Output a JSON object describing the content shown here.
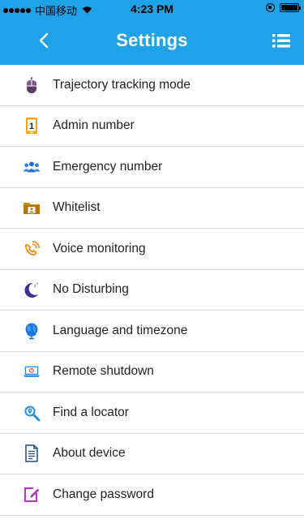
{
  "status_bar": {
    "carrier": "中国移动",
    "time": "4:23 PM"
  },
  "navbar": {
    "title": "Settings",
    "back_icon": "chevron-left-icon",
    "menu_icon": "list-menu-icon"
  },
  "colors": {
    "primary": "#1fa2e8",
    "divider": "#d9d9d9"
  },
  "settings": {
    "items": [
      {
        "label": "Trajectory tracking mode",
        "icon": "mouse-icon"
      },
      {
        "label": "Admin number",
        "icon": "phone-one-icon"
      },
      {
        "label": "Emergency number",
        "icon": "contacts-group-icon"
      },
      {
        "label": "Whitelist",
        "icon": "folder-contact-icon"
      },
      {
        "label": "Voice monitoring",
        "icon": "phone-ringing-icon"
      },
      {
        "label": "No Disturbing",
        "icon": "moon-sleep-icon"
      },
      {
        "label": "Language and timezone",
        "icon": "globe-icon"
      },
      {
        "label": "Remote shutdown",
        "icon": "laptop-power-icon"
      },
      {
        "label": "Find a locator",
        "icon": "search-location-icon"
      },
      {
        "label": "About device",
        "icon": "document-icon"
      },
      {
        "label": "Change password",
        "icon": "edit-icon"
      }
    ]
  }
}
